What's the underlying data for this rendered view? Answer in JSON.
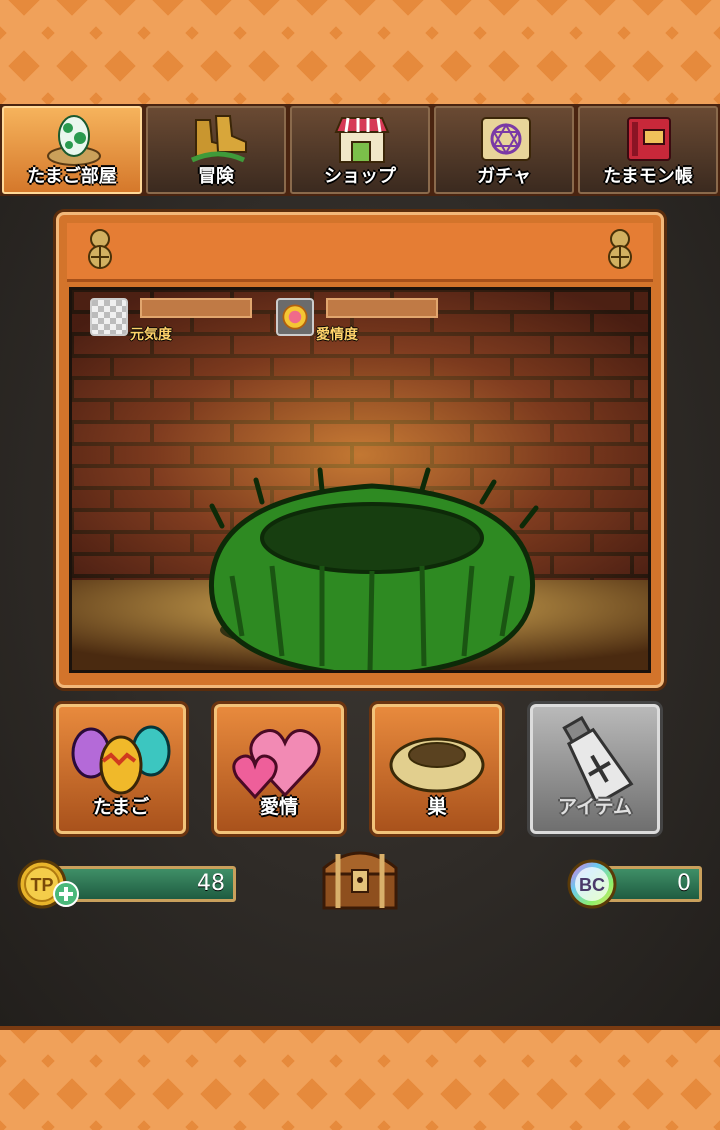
{
  "tabs": [
    {
      "label": "たまご部屋",
      "icon": "egg-in-nest-icon",
      "active": true
    },
    {
      "label": "冒険",
      "icon": "boots-icon",
      "active": false
    },
    {
      "label": "ショップ",
      "icon": "shop-icon",
      "active": false
    },
    {
      "label": "ガチャ",
      "icon": "magic-scroll-icon",
      "active": false
    },
    {
      "label": "たまモン帳",
      "icon": "book-icon",
      "active": false
    }
  ],
  "room": {
    "stats": [
      {
        "label": "元気度",
        "icon": "checkered-icon"
      },
      {
        "label": "愛情度",
        "icon": "sun-face-icon"
      }
    ]
  },
  "actions": [
    {
      "label": "たまご",
      "icon": "eggs-icon",
      "enabled": true
    },
    {
      "label": "愛情",
      "icon": "hearts-icon",
      "enabled": true
    },
    {
      "label": "巣",
      "icon": "nest-icon",
      "enabled": true
    },
    {
      "label": "アイテム",
      "icon": "potion-bottle-icon",
      "enabled": false
    }
  ],
  "currency": {
    "tp": {
      "badge": "TP",
      "value": "48"
    },
    "bc": {
      "badge": "BC",
      "value": "0"
    }
  },
  "colors": {
    "accent_orange": "#e68a3c",
    "meter_green": "#2f7a55"
  }
}
